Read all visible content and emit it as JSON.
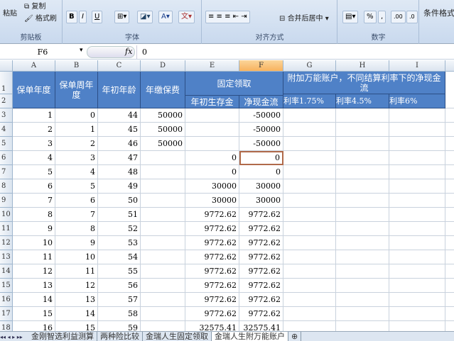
{
  "ribbon": {
    "clipboard": {
      "label": "剪贴板",
      "paste": "粘贴",
      "copy": "复制",
      "format_painter": "格式刷"
    },
    "font": {
      "label": "字体",
      "bold": "B",
      "italic": "I",
      "underline": "U",
      "font_color": "A",
      "phonetic": "文"
    },
    "alignment": {
      "label": "对齐方式",
      "merge_center": "合并后居中"
    },
    "number": {
      "label": "数字",
      "percent": "%",
      "comma": ",",
      "inc_decimal": ".00",
      "dec_decimal": ".0"
    },
    "styles": {
      "conditional_format": "条件格式"
    }
  },
  "formula_bar": {
    "name_box": "F6",
    "fx": "fx",
    "value": "0"
  },
  "columns": [
    "A",
    "B",
    "C",
    "D",
    "E",
    "F",
    "G",
    "H",
    "I"
  ],
  "selected_column": "F",
  "selected_cell": "F6",
  "headers": {
    "a": "保单年度",
    "b": "保单周年度",
    "c": "年初年龄",
    "d": "年缴保费",
    "ef": "固定领取",
    "e": "年初生存金",
    "f": "净现金流",
    "ghi": "附加万能账户，不同结算利率下的净现金流",
    "g": "利率1.75%",
    "h": "利率4.5%",
    "i": "利率6%"
  },
  "rows": [
    {
      "r": "3",
      "a": "1",
      "b": "0",
      "c": "44",
      "d": "50000",
      "e": "",
      "f": "-50000"
    },
    {
      "r": "4",
      "a": "2",
      "b": "1",
      "c": "45",
      "d": "50000",
      "e": "",
      "f": "-50000"
    },
    {
      "r": "5",
      "a": "3",
      "b": "2",
      "c": "46",
      "d": "50000",
      "e": "",
      "f": "-50000"
    },
    {
      "r": "6",
      "a": "4",
      "b": "3",
      "c": "47",
      "d": "",
      "e": "0",
      "f": "0"
    },
    {
      "r": "7",
      "a": "5",
      "b": "4",
      "c": "48",
      "d": "",
      "e": "0",
      "f": "0"
    },
    {
      "r": "8",
      "a": "6",
      "b": "5",
      "c": "49",
      "d": "",
      "e": "30000",
      "f": "30000"
    },
    {
      "r": "9",
      "a": "7",
      "b": "6",
      "c": "50",
      "d": "",
      "e": "30000",
      "f": "30000"
    },
    {
      "r": "10",
      "a": "8",
      "b": "7",
      "c": "51",
      "d": "",
      "e": "9772.62",
      "f": "9772.62"
    },
    {
      "r": "11",
      "a": "9",
      "b": "8",
      "c": "52",
      "d": "",
      "e": "9772.62",
      "f": "9772.62"
    },
    {
      "r": "12",
      "a": "10",
      "b": "9",
      "c": "53",
      "d": "",
      "e": "9772.62",
      "f": "9772.62"
    },
    {
      "r": "13",
      "a": "11",
      "b": "10",
      "c": "54",
      "d": "",
      "e": "9772.62",
      "f": "9772.62"
    },
    {
      "r": "14",
      "a": "12",
      "b": "11",
      "c": "55",
      "d": "",
      "e": "9772.62",
      "f": "9772.62"
    },
    {
      "r": "15",
      "a": "13",
      "b": "12",
      "c": "56",
      "d": "",
      "e": "9772.62",
      "f": "9772.62"
    },
    {
      "r": "16",
      "a": "14",
      "b": "13",
      "c": "57",
      "d": "",
      "e": "9772.62",
      "f": "9772.62"
    },
    {
      "r": "17",
      "a": "15",
      "b": "14",
      "c": "58",
      "d": "",
      "e": "9772.62",
      "f": "9772.62"
    },
    {
      "r": "18",
      "a": "16",
      "b": "15",
      "c": "59",
      "d": "",
      "e": "32575.41",
      "f": "32575.41"
    }
  ],
  "sheet_tabs": [
    "金刚智选利益测算",
    "两种险比较",
    "金瑞人生固定领取",
    "金瑞人生附万能账户"
  ],
  "active_tab": 3,
  "colors": {
    "header_fill": "#4f81c7",
    "selected_col_header": "#f7b25e",
    "selection_border": "#b06a4a"
  }
}
